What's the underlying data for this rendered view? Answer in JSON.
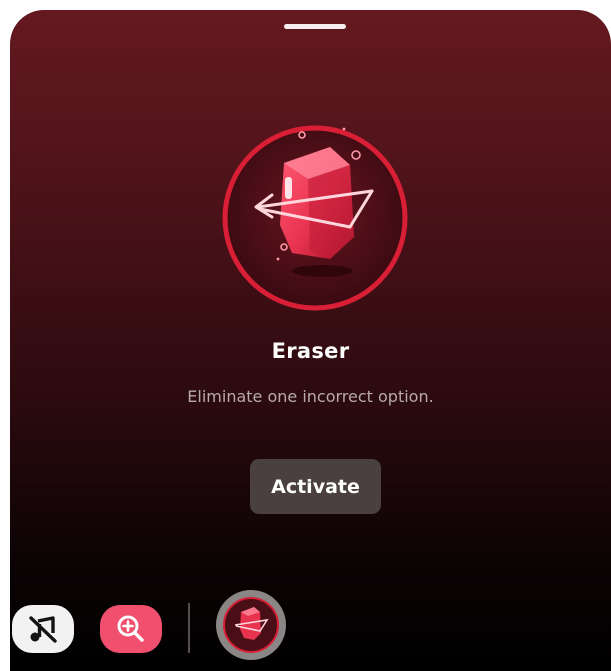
{
  "sheet": {
    "title": "Eraser",
    "description": "Eliminate one incorrect option.",
    "activate_label": "Activate",
    "hero_icon": "eraser-gem-icon"
  },
  "toolbar": {
    "items": [
      {
        "icon": "mute-icon",
        "state": "idle"
      },
      {
        "icon": "zoom-in-icon",
        "state": "idle"
      },
      {
        "icon": "eraser-gem-icon",
        "state": "selected"
      }
    ]
  },
  "colors": {
    "background_top": "#651820",
    "background_bottom": "#000000",
    "ring": "#d81f35",
    "gem": "#e8334f",
    "activate_button": "#4a4040",
    "zoom_button": "#f0506e",
    "mute_button": "#f2f2f2"
  }
}
